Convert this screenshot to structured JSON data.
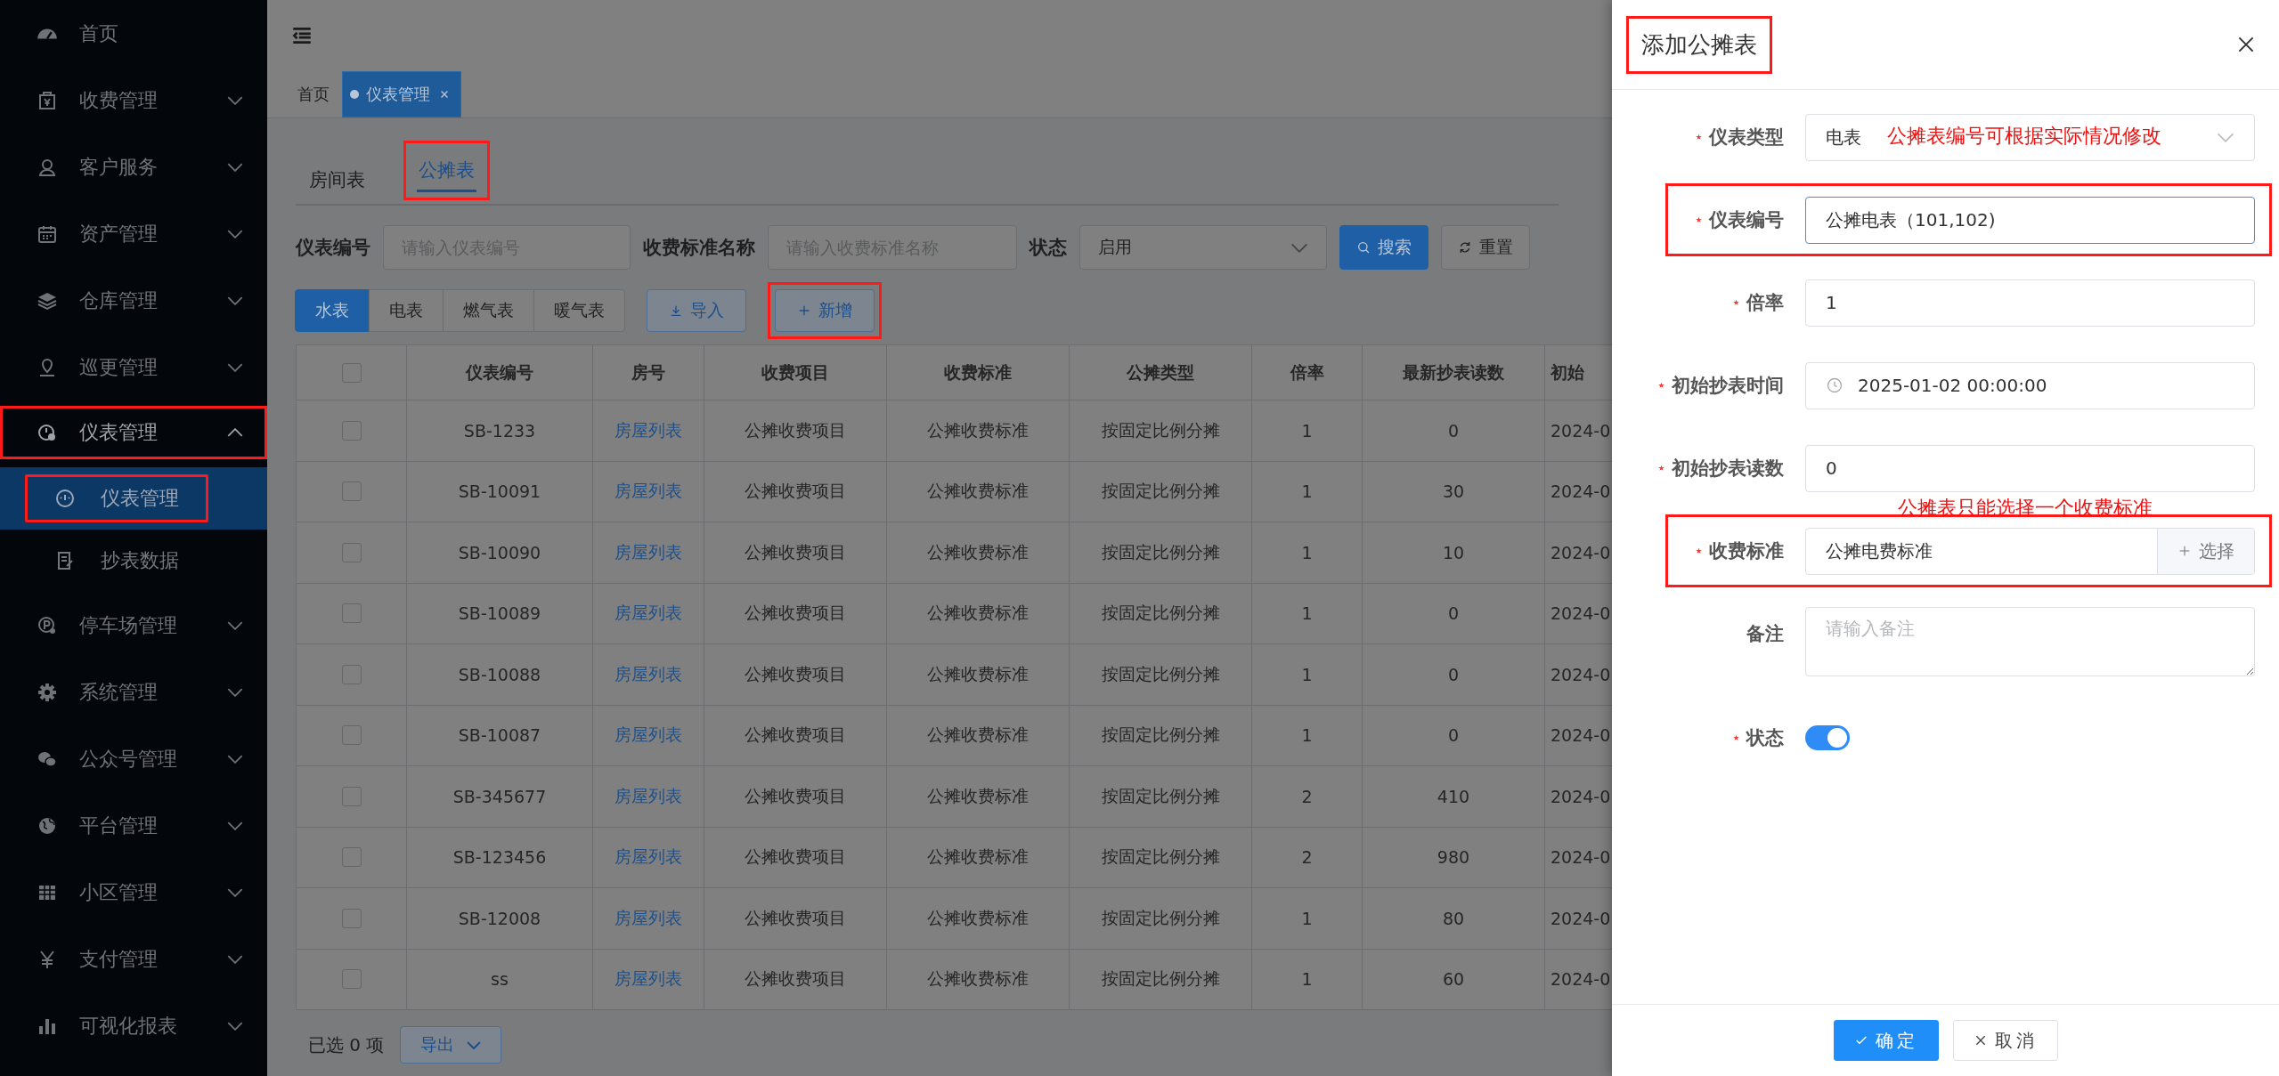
{
  "sidebar": {
    "items": [
      {
        "label": "首页",
        "kind": "link",
        "expanded": false
      },
      {
        "label": "收费管理",
        "kind": "group",
        "expanded": false
      },
      {
        "label": "客户服务",
        "kind": "group",
        "expanded": false
      },
      {
        "label": "资产管理",
        "kind": "group",
        "expanded": false
      },
      {
        "label": "仓库管理",
        "kind": "group",
        "expanded": false
      },
      {
        "label": "巡更管理",
        "kind": "group",
        "expanded": false
      },
      {
        "label": "仪表管理",
        "kind": "group",
        "expanded": true,
        "highlighted": true,
        "children": [
          {
            "label": "仪表管理",
            "selected": true,
            "highlighted": true
          },
          {
            "label": "抄表数据",
            "selected": false,
            "highlighted": false
          }
        ]
      },
      {
        "label": "停车场管理",
        "kind": "group",
        "expanded": false
      },
      {
        "label": "系统管理",
        "kind": "group",
        "expanded": false
      },
      {
        "label": "公众号管理",
        "kind": "group",
        "expanded": false
      },
      {
        "label": "平台管理",
        "kind": "group",
        "expanded": false
      },
      {
        "label": "小区管理",
        "kind": "group",
        "expanded": false
      },
      {
        "label": "支付管理",
        "kind": "group",
        "expanded": false
      },
      {
        "label": "可视化报表",
        "kind": "group",
        "expanded": false
      }
    ]
  },
  "page_tabs": [
    {
      "label": "首页",
      "selected": false,
      "closable": false
    },
    {
      "label": "仪表管理",
      "selected": true,
      "closable": true
    }
  ],
  "meter_tabs": [
    {
      "label": "房间表",
      "selected": false,
      "highlighted": false
    },
    {
      "label": "公摊表",
      "selected": true,
      "highlighted": true
    }
  ],
  "filters": [
    {
      "label": "仪表编号",
      "kind": "text",
      "placeholder": "请输入仪表编号"
    },
    {
      "label": "收费标准名称",
      "kind": "text",
      "placeholder": "请输入收费标准名称"
    },
    {
      "label": "状态",
      "kind": "select",
      "value": "启用"
    }
  ],
  "filter_buttons": [
    {
      "label": "搜索",
      "kind": "primary"
    },
    {
      "label": "重置",
      "kind": "default"
    }
  ],
  "type_buttons": [
    {
      "label": "水表",
      "selected": true
    },
    {
      "label": "电表",
      "selected": false
    },
    {
      "label": "燃气表",
      "selected": false
    },
    {
      "label": "暖气表",
      "selected": false
    }
  ],
  "actions": [
    {
      "label": "导入",
      "kind": "import",
      "highlighted": false
    },
    {
      "label": "新增",
      "kind": "add",
      "highlighted": true
    }
  ],
  "table": {
    "header_checked": false,
    "columns": [
      {
        "label": "仪表编号",
        "kind": "text"
      },
      {
        "label": "房号",
        "kind": "link"
      },
      {
        "label": "收费项目",
        "kind": "text"
      },
      {
        "label": "收费标准",
        "kind": "text"
      },
      {
        "label": "公摊类型",
        "kind": "text"
      },
      {
        "label": "倍率",
        "kind": "text"
      },
      {
        "label": "最新抄表读数",
        "kind": "text"
      },
      {
        "label": "初始",
        "kind": "cut"
      }
    ],
    "rows": [
      {
        "checked": false,
        "cells": [
          "SB-1233",
          "房屋列表",
          "公摊收费项目",
          "公摊收费标准",
          "按固定比例分摊",
          "1",
          "0",
          "2024-0"
        ]
      },
      {
        "checked": false,
        "cells": [
          "SB-10091",
          "房屋列表",
          "公摊收费项目",
          "公摊收费标准",
          "按固定比例分摊",
          "1",
          "30",
          "2024-0"
        ]
      },
      {
        "checked": false,
        "cells": [
          "SB-10090",
          "房屋列表",
          "公摊收费项目",
          "公摊收费标准",
          "按固定比例分摊",
          "1",
          "10",
          "2024-0"
        ]
      },
      {
        "checked": false,
        "cells": [
          "SB-10089",
          "房屋列表",
          "公摊收费项目",
          "公摊收费标准",
          "按固定比例分摊",
          "1",
          "0",
          "2024-0"
        ]
      },
      {
        "checked": false,
        "cells": [
          "SB-10088",
          "房屋列表",
          "公摊收费项目",
          "公摊收费标准",
          "按固定比例分摊",
          "1",
          "0",
          "2024-0"
        ]
      },
      {
        "checked": false,
        "cells": [
          "SB-10087",
          "房屋列表",
          "公摊收费项目",
          "公摊收费标准",
          "按固定比例分摊",
          "1",
          "0",
          "2024-0"
        ]
      },
      {
        "checked": false,
        "cells": [
          "SB-345677",
          "房屋列表",
          "公摊收费项目",
          "公摊收费标准",
          "按固定比例分摊",
          "2",
          "410",
          "2024-0"
        ]
      },
      {
        "checked": false,
        "cells": [
          "SB-123456",
          "房屋列表",
          "公摊收费项目",
          "公摊收费标准",
          "按固定比例分摊",
          "2",
          "980",
          "2024-0"
        ]
      },
      {
        "checked": false,
        "cells": [
          "SB-12008",
          "房屋列表",
          "公摊收费项目",
          "公摊收费标准",
          "按固定比例分摊",
          "1",
          "80",
          "2024-0"
        ]
      },
      {
        "checked": false,
        "cells": [
          "ss",
          "房屋列表",
          "公摊收费项目",
          "公摊收费标准",
          "按固定比例分摊",
          "1",
          "60",
          "2024-0"
        ]
      }
    ]
  },
  "footer": {
    "selected_text": "已选 0 项",
    "export_button": "导出"
  },
  "drawer": {
    "title": "添加公摊表",
    "highlighted": true,
    "fields": [
      {
        "label": "仪表类型",
        "required": true,
        "kind": "select",
        "value": "电表",
        "note": "公摊表编号可根据实际情况修改",
        "highlighted": false
      },
      {
        "label": "仪表编号",
        "required": true,
        "kind": "text",
        "value": "公摊电表（101,102)",
        "focused": true,
        "highlighted": true
      },
      {
        "label": "倍率",
        "required": true,
        "kind": "text",
        "value": "1",
        "focused": false,
        "highlighted": false
      },
      {
        "label": "初始抄表时间",
        "required": true,
        "kind": "date",
        "value": "2025-01-02 00:00:00",
        "highlighted": false
      },
      {
        "label": "初始抄表读数",
        "required": true,
        "kind": "text",
        "value": "0",
        "focused": false,
        "note": "公摊表只能选择一个收费标准",
        "highlighted": false
      },
      {
        "label": "收费标准",
        "required": true,
        "kind": "picker",
        "value": "公摊电费标准",
        "button": "选择",
        "highlighted": true
      },
      {
        "label": "备注",
        "required": false,
        "kind": "textarea",
        "placeholder": "请输入备注",
        "highlighted": false
      },
      {
        "label": "状态",
        "required": true,
        "kind": "switch",
        "on": true,
        "highlighted": false
      }
    ],
    "buttons": [
      {
        "label": "确定",
        "kind": "primary"
      },
      {
        "label": "取消",
        "kind": "default"
      }
    ]
  }
}
